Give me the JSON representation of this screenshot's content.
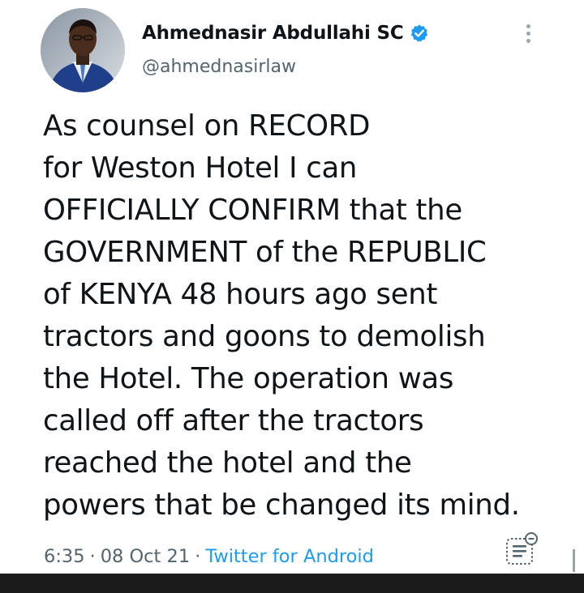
{
  "author": {
    "display_name": "Ahmednasir Abdullahi SC",
    "handle": "@ahmednasirlaw",
    "verified": true,
    "avatar_icon": "profile-photo",
    "verified_icon": "verified-badge-icon"
  },
  "menu": {
    "icon": "more-vertical-icon"
  },
  "tweet": {
    "text_lines": [
      "As counsel on RECORD",
      "for Weston Hotel I can",
      "OFFICIALLY CONFIRM that the",
      "GOVERNMENT of the REPUBLIC",
      "of KENYA 48 hours ago sent",
      "tractors and goons to demolish",
      "the Hotel. The operation was",
      "called off after the tractors",
      "reached the hotel and the",
      "powers that be changed its mind."
    ]
  },
  "meta": {
    "time": "6:35",
    "separator": "·",
    "date": "08 Oct 21",
    "source": "Twitter for Android",
    "analytics_icon": "view-analytics-icon"
  },
  "colors": {
    "text": "#0f1419",
    "secondary": "#536471",
    "link": "#1d9bf0",
    "verified": "#1d9bf0",
    "bottom_bar": "#1b1b1b"
  }
}
